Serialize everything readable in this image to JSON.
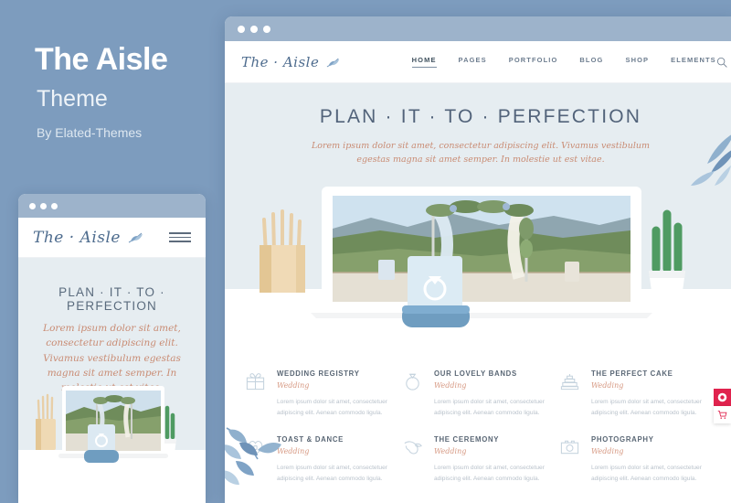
{
  "promo": {
    "title": "The Aisle",
    "subtitle": "Theme",
    "author": "By Elated-Themes"
  },
  "colors": {
    "page_background": "#7d9cbe",
    "hero_background": "#e6edf1",
    "accent_rose": "#d79a84",
    "logo_blue": "#4e6c8e",
    "widget_red": "#e0234e"
  },
  "browser": {
    "titlebar_dots": 3
  },
  "site": {
    "logo": "The · Aisle",
    "nav": [
      {
        "label": "HOME",
        "active": true
      },
      {
        "label": "PAGES",
        "active": false
      },
      {
        "label": "PORTFOLIO",
        "active": false
      },
      {
        "label": "BLOG",
        "active": false
      },
      {
        "label": "SHOP",
        "active": false
      },
      {
        "label": "ELEMENTS",
        "active": false
      }
    ],
    "icons": {
      "search": "search-icon",
      "cart": "shopping-bag-icon",
      "cart_count": "0",
      "menu": "hamburger-menu-icon"
    }
  },
  "hero": {
    "heading": "PLAN · IT · TO · PERFECTION",
    "subtitle_line1": "Lorem ipsum dolor sit amet, consectetur adipiscing elit. Vivamus vestibulum",
    "subtitle_line2": "egestas magna sit amet semper. In molestie ut est vitae."
  },
  "mobile": {
    "logo": "The · Aisle",
    "heading": "PLAN · IT · TO · PERFECTION",
    "subtitle": "Lorem ipsum dolor sit amet, consectetur adipiscing elit. Vivamus vestibulum egestas magna sit amet semper. In molestie ut est vitae."
  },
  "services": [
    {
      "icon": "gift-icon",
      "title": "WEDDING REGISTRY",
      "tag": "Wedding",
      "text": "Lorem ipsum dolor sit amet, consectetuer adipiscing elit. Aenean commodo ligula."
    },
    {
      "icon": "ring-icon",
      "title": "OUR LOVELY BANDS",
      "tag": "Wedding",
      "text": "Lorem ipsum dolor sit amet, consectetuer adipiscing elit. Aenean commodo ligula."
    },
    {
      "icon": "cake-icon",
      "title": "THE PERFECT CAKE",
      "tag": "Wedding",
      "text": "Lorem ipsum dolor sit amet, consectetuer adipiscing elit. Aenean commodo ligula."
    },
    {
      "icon": "heart-lock-icon",
      "title": "TOAST & DANCE",
      "tag": "Wedding",
      "text": "Lorem ipsum dolor sit amet, consectetuer adipiscing elit. Aenean commodo ligula."
    },
    {
      "icon": "dove-icon",
      "title": "THE CEREMONY",
      "tag": "Wedding",
      "text": "Lorem ipsum dolor sit amet, consectetuer adipiscing elit. Aenean commodo ligula."
    },
    {
      "icon": "camera-icon",
      "title": "PHOTOGRAPHY",
      "tag": "Wedding",
      "text": "Lorem ipsum dolor sit amet, consectetuer adipiscing elit. Aenean commodo ligula."
    }
  ],
  "widgets": [
    {
      "icon": "purchase-badge-icon"
    },
    {
      "icon": "cart-icon"
    }
  ]
}
